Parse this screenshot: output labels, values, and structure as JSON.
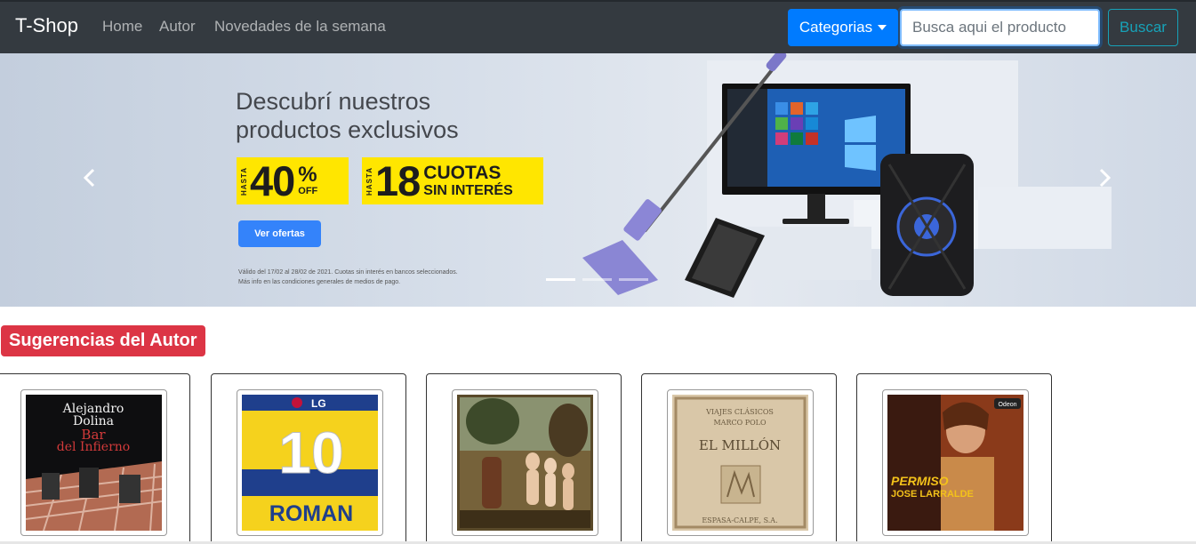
{
  "navbar": {
    "brand": "T-Shop",
    "links": [
      "Home",
      "Autor",
      "Novedades de la semana"
    ],
    "categories_label": "Categorias",
    "search_placeholder": "Busca aqui el producto",
    "search_button": "Buscar"
  },
  "carousel": {
    "title_line1": "Descubrí nuestros",
    "title_line2": "productos exclusivos",
    "promo1": {
      "hasta": "HASTA",
      "big": "40",
      "pct": "%",
      "off": "OFF"
    },
    "promo2": {
      "hasta": "HASTA",
      "big": "18",
      "line1": "CUOTAS",
      "line2": "SIN INTERÉS"
    },
    "cta": "Ver ofertas",
    "legal_line1": "Válido del 17/02 al 28/02 de 2021. Cuotas sin interés en bancos seleccionados.",
    "legal_line2": "Más info en las condiciones generales de medios de pago.",
    "indicator_count": 3,
    "active_indicator": 0
  },
  "section": {
    "title": "Sugerencias del Autor"
  },
  "products": [
    {
      "icon": "book-cover-icon",
      "cover_line1": "Alejandro",
      "cover_line2": "Dolina",
      "cover_line3": "Bar",
      "cover_line4": "del Infierno"
    },
    {
      "icon": "jersey-icon",
      "badge": "LG",
      "number": "10",
      "name": "ROMAN"
    },
    {
      "icon": "painting-icon"
    },
    {
      "icon": "old-book-icon",
      "top1": "VIAJES CLÁSICOS",
      "top2": "MARCO POLO",
      "title": "EL MILLÓN",
      "bottom": "ESPASA-CALPE, S.A."
    },
    {
      "icon": "album-cover-icon",
      "label": "Odeon",
      "title": "PERMISO",
      "artist": "JOSE LARRALDE"
    }
  ],
  "colors": {
    "navbar": "#343a40",
    "primary": "#007bff",
    "info": "#17a2b8",
    "danger": "#dc3545",
    "promo_yellow": "#ffe600",
    "cta_blue": "#3483fa"
  }
}
